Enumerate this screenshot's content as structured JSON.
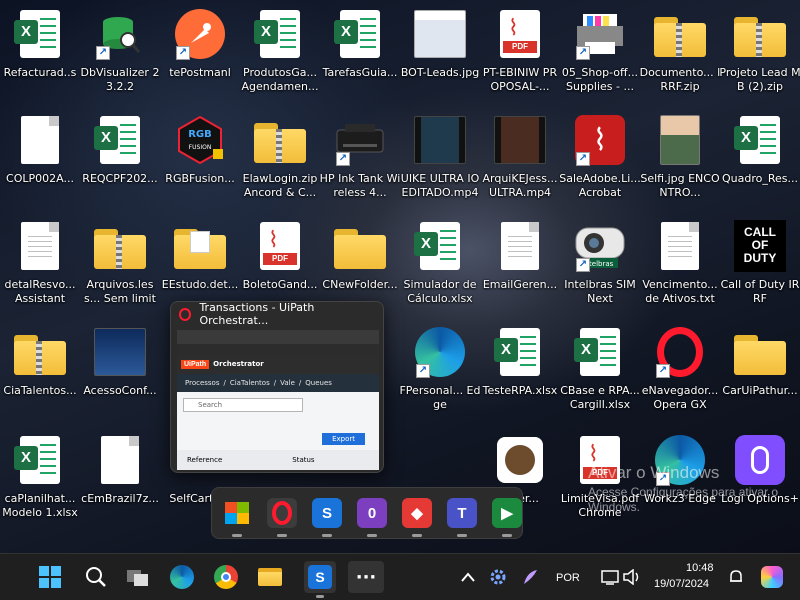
{
  "desktop": {
    "icons": [
      {
        "label": "Refacturad..s"
      },
      {
        "label": "DbVisualizer 23.2.2"
      },
      {
        "label": "tePostmanl"
      },
      {
        "label": "ProdutosGa... Agendamen..."
      },
      {
        "label": "TarefasGuia..."
      },
      {
        "label": "BOT-Leads.jpg"
      },
      {
        "label": "PT-EBINIW PROPOSAL-..."
      },
      {
        "label": "05_Shop-off... Supplies - ..."
      },
      {
        "label": "Documento... IRRF.zip"
      },
      {
        "label": "Projeto Lead MB (2).zip"
      },
      {
        "label": "COLP002A..."
      },
      {
        "label": "REQCPF202..."
      },
      {
        "label": "RGBFusion..."
      },
      {
        "label": "ElawLogin.zip Ancord & C..."
      },
      {
        "label": "HP Ink Tank Wireless 4..."
      },
      {
        "label": "UIKE ULTRA IO EDITADO.mp4"
      },
      {
        "label": "ArquiKEJess... ULTRA.mp4"
      },
      {
        "label": "SaleAdobe.Li... Acrobat"
      },
      {
        "label": "Selfi.jpg ENCONTRO..."
      },
      {
        "label": "Quadro_Res..."
      },
      {
        "label": "detalResvo... Assistant"
      },
      {
        "label": "Arquivos.less... Sem limite..."
      },
      {
        "label": "EEstudo.det..."
      },
      {
        "label": "BoletoGand..."
      },
      {
        "label": "CNewFolder..."
      },
      {
        "label": "Simulador de Cálculo.xlsx"
      },
      {
        "label": "EmailGeren..."
      },
      {
        "label": "Intelbras SIM Next"
      },
      {
        "label": "Vencimento... de Ativos.txt"
      },
      {
        "label": "Call of Duty IRRF"
      },
      {
        "label": "CiaTalentos..."
      },
      {
        "label": "AcessoConf..."
      },
      {
        "label": "FPersonal... Edge"
      },
      {
        "label": "TesteRPA.xlsx"
      },
      {
        "label": "CBase e RPA... Cargill.xlsx"
      },
      {
        "label": "eNavegador... Opera GX"
      },
      {
        "label": "CarUiPathur..."
      },
      {
        "label": "caPlanilhat... Modelo 1.xlsx"
      },
      {
        "label": "cEmBrazil7z..."
      },
      {
        "label": "SelfCarta..."
      },
      {
        "label": "...ver..."
      },
      {
        "label": "LimiteVisa.pdf Chrome"
      },
      {
        "label": "Workz3 Edge"
      },
      {
        "label": "Logi Options+"
      }
    ]
  },
  "watermark": {
    "line1": "Ativar o Windows",
    "line2": "Acesse Configurações para ativar o Windows."
  },
  "preview": {
    "title": "Transactions - UiPath Orchestrat...",
    "logo": "UiPath",
    "app_name": "Orchestrator",
    "breadcrumb": [
      "Processos",
      "/",
      "CiaTalentos",
      "/",
      "Vale",
      "/",
      "Queues"
    ],
    "search_placeholder": "Search",
    "export_label": "Export",
    "col_reference": "Reference",
    "col_status": "Status"
  },
  "taskbar": {
    "lang": "POR",
    "time": "10:48",
    "date": "19/07/2024",
    "icons": [
      "start-icon",
      "search-icon",
      "task-view-icon",
      "edge-icon",
      "chrome-icon",
      "file-explorer-icon",
      "uipath-studio-icon",
      "more-icon"
    ]
  },
  "colors": {
    "taskbar_bg": "#1f1f1f",
    "excel_green": "#1d7044",
    "pdf_red": "#d9342b",
    "folder_yellow": "#f2bd3a",
    "opera_red": "#ff1b2d"
  }
}
